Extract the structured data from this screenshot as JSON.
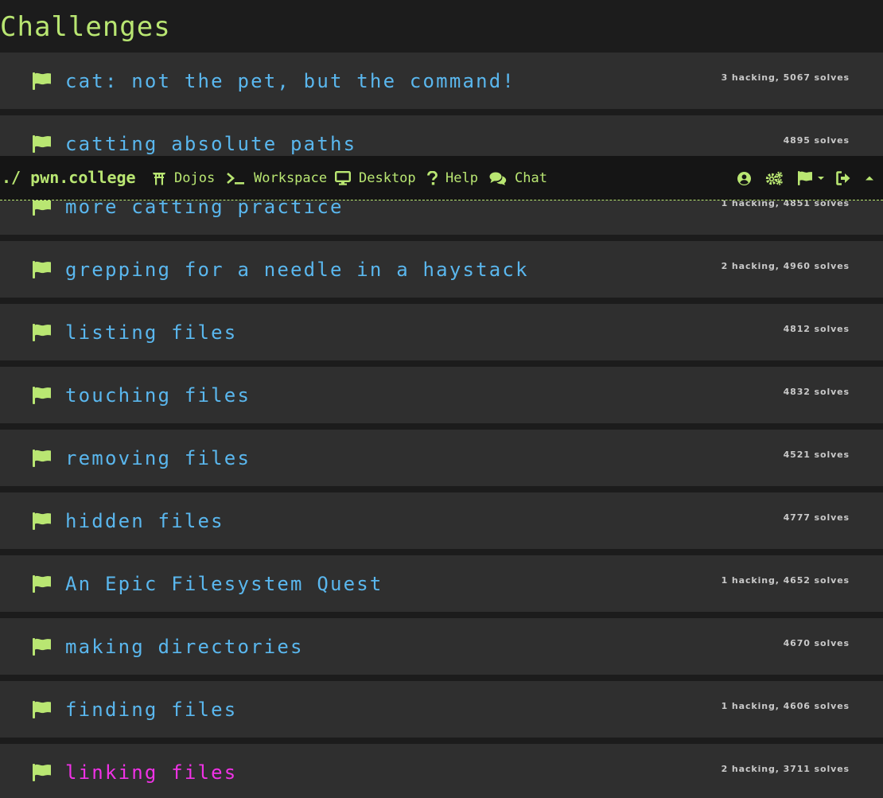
{
  "page_title": "Challenges",
  "colors": {
    "accent": "#b9e672",
    "challenge_link": "#5ab7ee",
    "active_challenge": "#f032e6",
    "row_background": "#2f2f2f",
    "page_background": "#1c1c1c"
  },
  "navbar": {
    "brand": "./ pwn.college",
    "items": [
      {
        "label": "Dojos",
        "icon": "torii-gate-icon"
      },
      {
        "label": "Workspace",
        "icon": "terminal-icon"
      },
      {
        "label": "Desktop",
        "icon": "desktop-icon"
      },
      {
        "label": "Help",
        "icon": "question-icon"
      },
      {
        "label": "Chat",
        "icon": "comments-icon"
      }
    ],
    "right_icons": [
      "user-circle-icon",
      "gears-icon",
      "flag-dropdown-icon",
      "sign-out-icon",
      "caret-up-icon"
    ]
  },
  "challenges": [
    {
      "name": "cat: not the pet, but the command!",
      "stats": "3 hacking, 5067 solves"
    },
    {
      "name": "catting absolute paths",
      "stats": "4895 solves"
    },
    {
      "name": "more catting practice",
      "stats": "1 hacking, 4851 solves"
    },
    {
      "name": "grepping for a needle in a haystack",
      "stats": "2 hacking, 4960 solves"
    },
    {
      "name": "listing files",
      "stats": "4812 solves"
    },
    {
      "name": "touching files",
      "stats": "4832 solves"
    },
    {
      "name": "removing files",
      "stats": "4521 solves"
    },
    {
      "name": "hidden files",
      "stats": "4777 solves"
    },
    {
      "name": "An Epic Filesystem Quest",
      "stats": "1 hacking, 4652 solves"
    },
    {
      "name": "making directories",
      "stats": "4670 solves"
    },
    {
      "name": "finding files",
      "stats": "1 hacking, 4606 solves"
    },
    {
      "name": "linking files",
      "stats": "2 hacking, 3711 solves",
      "active": true
    }
  ]
}
